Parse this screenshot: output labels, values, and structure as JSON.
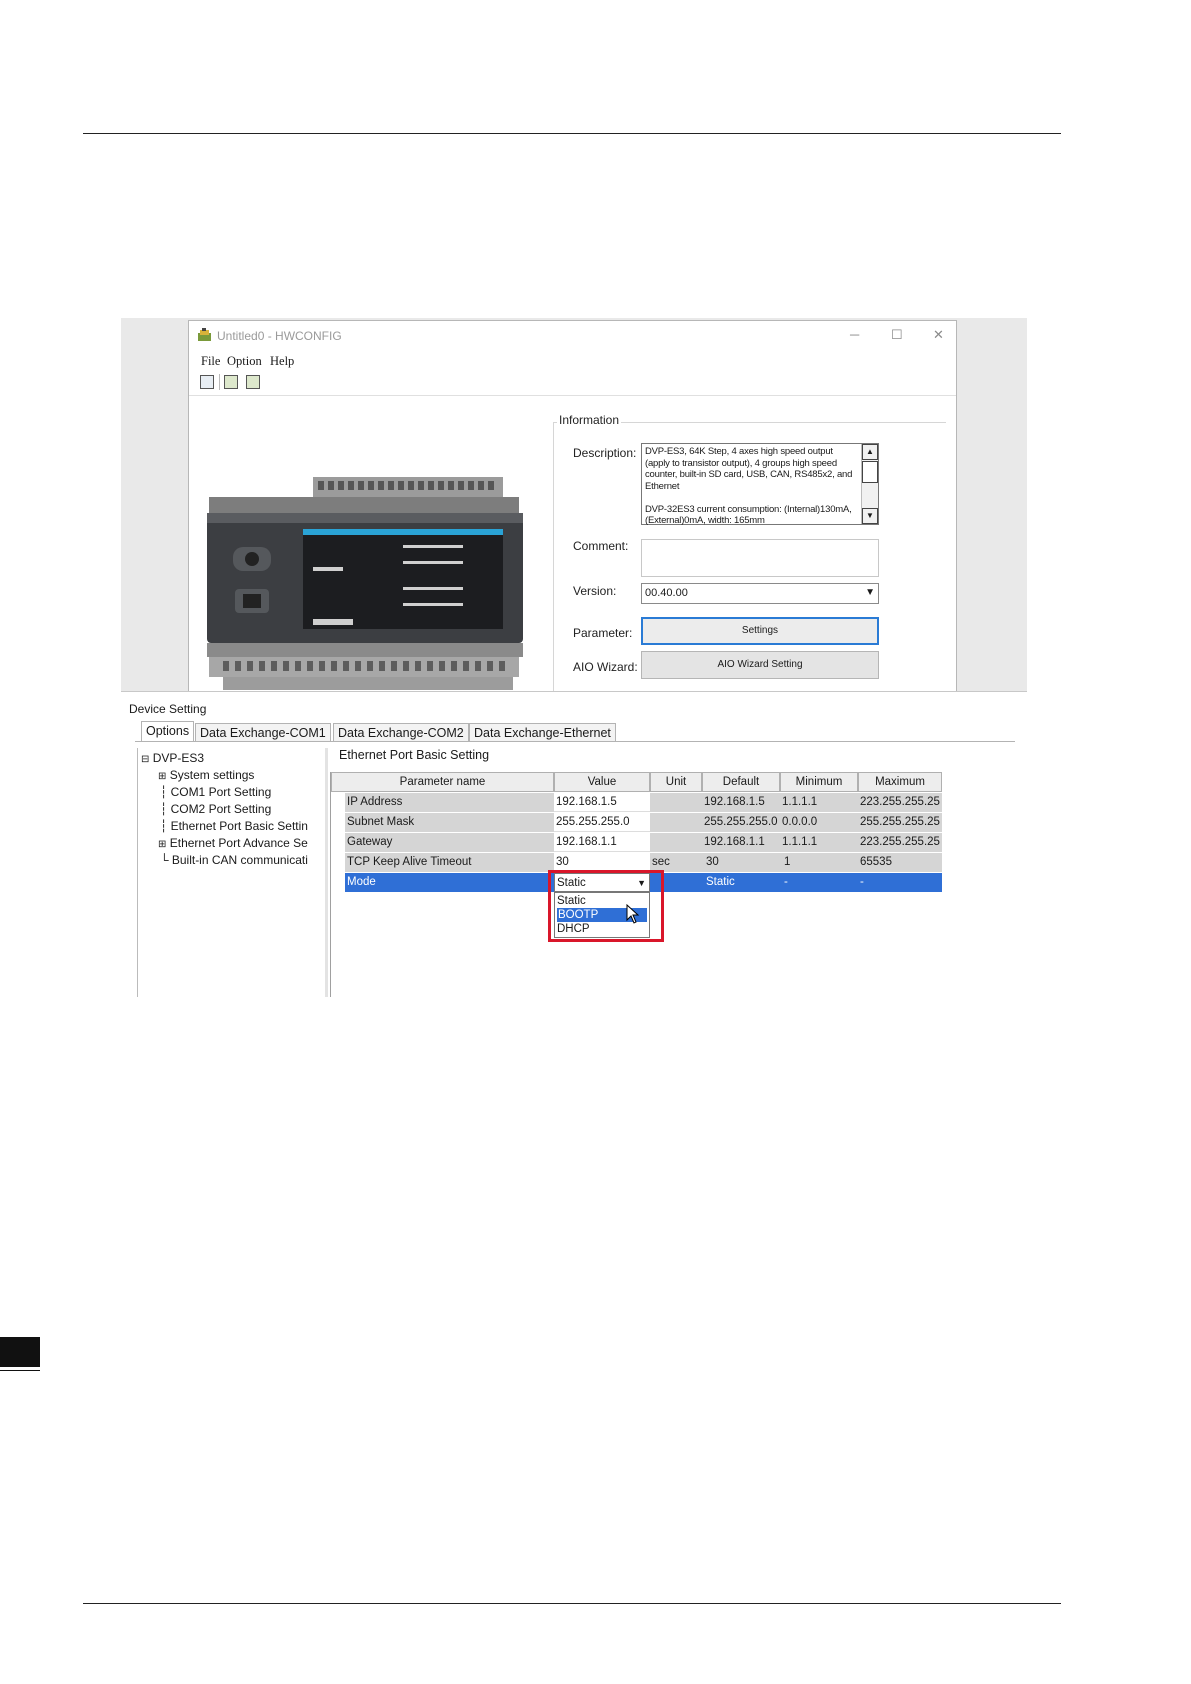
{
  "window": {
    "title": "Untitled0 - HWCONFIG",
    "menu": [
      "File",
      "Option",
      "Help"
    ]
  },
  "information": {
    "group_label": "Information",
    "description_label": "Description:",
    "description_lines": [
      "DVP-ES3, 64K Step, 4 axes high speed output",
      "(apply to transistor output), 4 groups high speed",
      "counter, built-in SD card, USB, CAN, RS485x2, and",
      "Ethernet",
      "",
      "DVP-32ES3 current consumption: (Internal)130mA,",
      "(External)0mA, width: 165mm"
    ],
    "comment_label": "Comment:",
    "version_label": "Version:",
    "version_value": "00.40.00",
    "parameter_label": "Parameter:",
    "parameter_button": "Settings",
    "aio_label": "AIO Wizard:",
    "aio_button": "AIO Wizard Setting"
  },
  "device_setting": {
    "title": "Device Setting",
    "tabs": [
      "Options",
      "Data Exchange-COM1",
      "Data Exchange-COM2",
      "Data Exchange-Ethernet"
    ],
    "tree": {
      "root": "DVP-ES3",
      "items": [
        "System settings",
        "COM1 Port Setting",
        "COM2 Port Setting",
        "Ethernet Port Basic Settin",
        "Ethernet Port Advance Se",
        "Built-in CAN communicati"
      ]
    },
    "section_title": "Ethernet Port Basic Setting",
    "columns": [
      "Parameter name",
      "Value",
      "Unit",
      "Default",
      "Minimum",
      "Maximum"
    ],
    "rows": [
      [
        "IP Address",
        "192.168.1.5",
        "",
        "192.168.1.5",
        "1.1.1.1",
        "223.255.255.25"
      ],
      [
        "Subnet Mask",
        "255.255.255.0",
        "",
        "255.255.255.0",
        "0.0.0.0",
        "255.255.255.25"
      ],
      [
        "Gateway",
        "192.168.1.1",
        "",
        "192.168.1.1",
        "1.1.1.1",
        "223.255.255.25"
      ],
      [
        "TCP Keep Alive Timeout",
        "30",
        "sec",
        "30",
        "1",
        "65535"
      ],
      [
        "Mode",
        "Static",
        "",
        "Static",
        "-",
        "-"
      ]
    ],
    "dropdown_options": [
      "Static",
      "BOOTP",
      "DHCP"
    ],
    "dropdown_highlighted": "BOOTP"
  },
  "colors": {
    "selection": "#2f6fd6",
    "highlight_frame": "#d9162a",
    "grid_row": "#d5d5d5"
  }
}
